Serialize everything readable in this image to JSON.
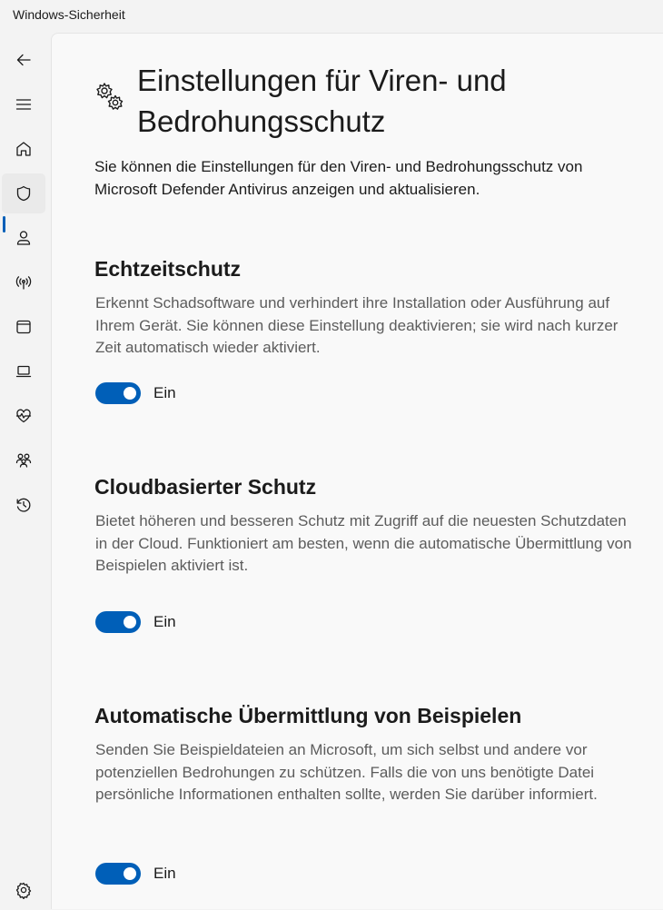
{
  "window": {
    "title": "Windows-Sicherheit"
  },
  "nav": {
    "items": [
      {
        "icon": "back-arrow-icon"
      },
      {
        "icon": "hamburger-menu-icon"
      },
      {
        "icon": "home-icon"
      },
      {
        "icon": "shield-icon",
        "active": true
      },
      {
        "icon": "person-icon"
      },
      {
        "icon": "wireless-antenna-icon"
      },
      {
        "icon": "app-window-icon"
      },
      {
        "icon": "laptop-icon"
      },
      {
        "icon": "heart-pulse-icon"
      },
      {
        "icon": "family-icon"
      },
      {
        "icon": "history-icon"
      },
      {
        "icon": "gear-icon"
      }
    ],
    "accent_color": "#005fb8"
  },
  "page": {
    "icon": "gears-icon",
    "title": "Einstellungen für Viren- und Bedrohungsschutz",
    "description": "Sie können die Einstellungen für den Viren- und Bedrohungsschutz von Microsoft Defender Antivirus anzeigen und aktualisieren."
  },
  "sections": [
    {
      "title": "Echtzeitschutz",
      "description": "Erkennt Schadsoftware und verhindert ihre Installation oder Ausführung auf Ihrem Gerät. Sie können diese Einstellung deaktivieren; sie wird nach kurzer Zeit automatisch wieder aktiviert.",
      "toggle_label": "Ein",
      "on": true
    },
    {
      "title": "Cloudbasierter Schutz",
      "description": "Bietet höheren und besseren Schutz mit Zugriff auf die neuesten Schutzdaten in der Cloud. Funktioniert am besten, wenn die automatische Übermittlung von Beispielen aktiviert ist.",
      "toggle_label": "Ein",
      "on": true
    },
    {
      "title": "Automatische Übermittlung von Beispielen",
      "description": "Senden Sie Beispieldateien an Microsoft, um sich selbst und andere vor potenziellen Bedrohungen zu schützen. Falls die von uns benötigte Datei persönliche Informationen enthalten sollte, werden Sie darüber informiert.",
      "toggle_label": "Ein",
      "on": true
    }
  ]
}
